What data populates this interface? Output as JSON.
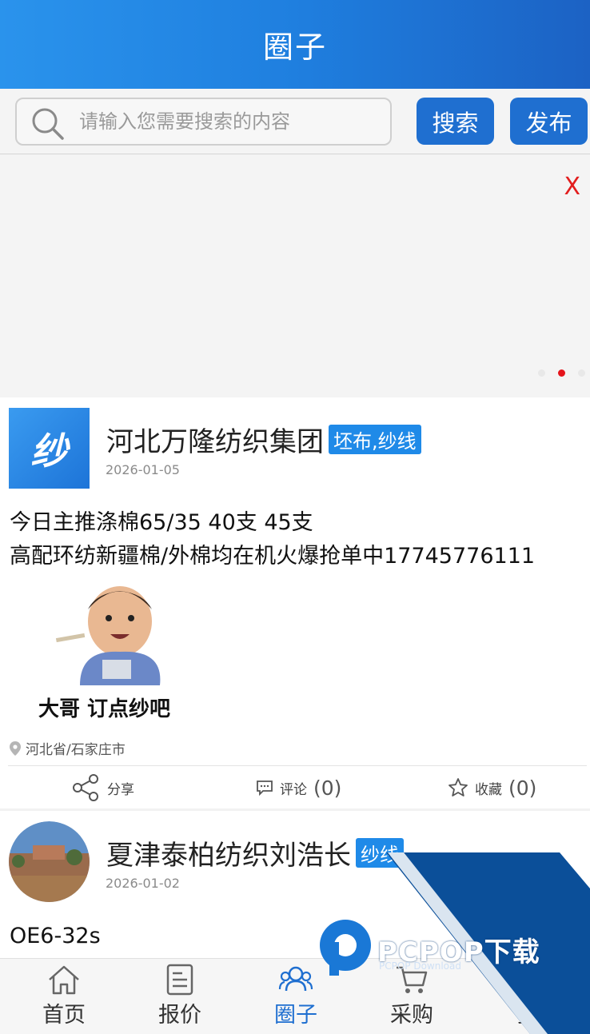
{
  "header": {
    "title": "圈子"
  },
  "search": {
    "placeholder": "请输入您需要搜索的内容",
    "search_label": "搜索",
    "publish_label": "发布"
  },
  "banner": {
    "close_label": "X"
  },
  "posts": [
    {
      "author": "河北万隆纺织集团",
      "avatar_text": "纱",
      "tag": "坯布,纱线",
      "date": "2026-01-05",
      "content_lines": [
        "今日主推涤棉65/35 40支 45支",
        "高配环纺新疆棉/外棉均在机火爆抢单中17745776111"
      ],
      "sticker_caption": "大哥 订点纱吧",
      "location": "河北省/石家庄市",
      "share_label": "分享",
      "comment_label": "评论",
      "comment_count": "(0)",
      "fav_label": "收藏",
      "fav_count": "(0)"
    },
    {
      "author": "夏津泰柏纺织刘浩长",
      "tag": "纱线",
      "date": "2026-01-02",
      "content_lines": [
        "OE6-32s"
      ]
    }
  ],
  "tabs": [
    {
      "label": "首页",
      "icon": "home-icon"
    },
    {
      "label": "报价",
      "icon": "document-icon"
    },
    {
      "label": "圈子",
      "icon": "people-icon",
      "active": true
    },
    {
      "label": "采购",
      "icon": "cart-icon"
    },
    {
      "label": "找"
    }
  ],
  "watermark": {
    "text": "PCPOP下载",
    "sub": "PCPOP Download"
  },
  "colors": {
    "primary": "#1f6fd0",
    "header_gradient_start": "#2a93ec",
    "tag_bg": "#1f8ae8",
    "close_red": "#e21d1d"
  }
}
